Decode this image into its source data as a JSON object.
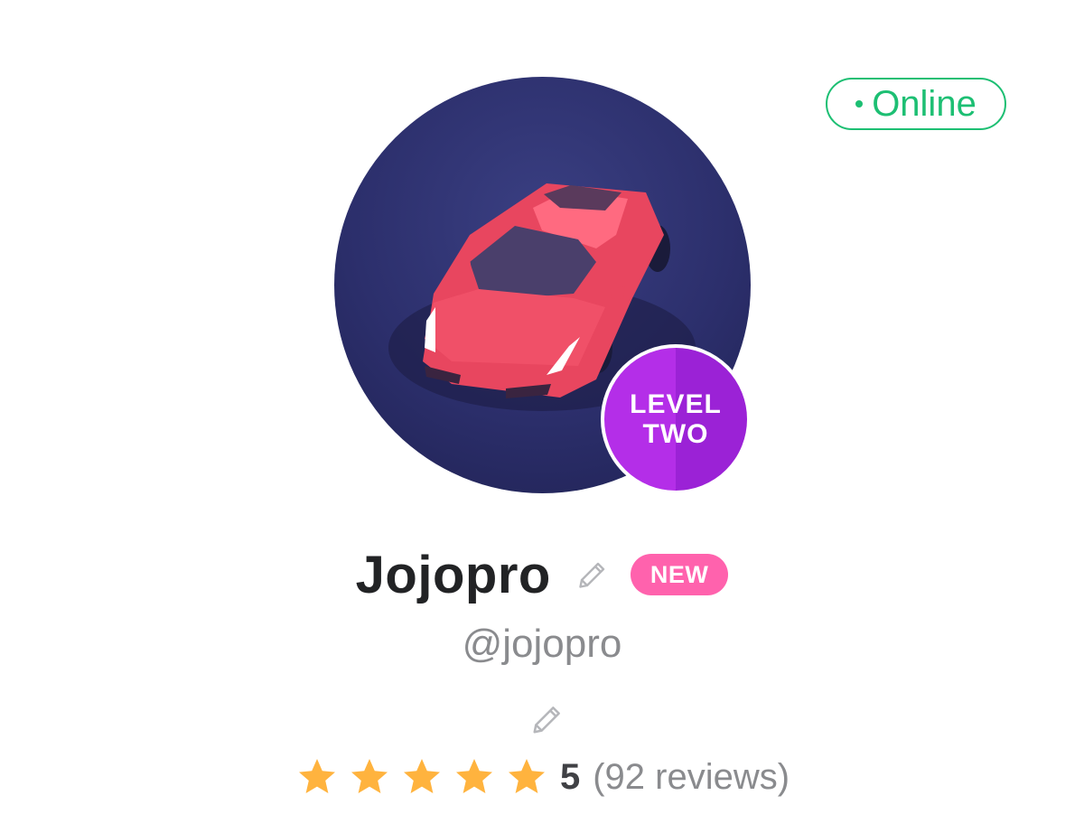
{
  "status": {
    "label": "Online",
    "color": "#1dbf73"
  },
  "avatar": {
    "icon": "sports-car-avatar"
  },
  "level_badge": {
    "line1": "LEVEL",
    "line2": "TWO"
  },
  "profile": {
    "name": "Jojopro",
    "new_badge": "NEW",
    "username": "@jojopro",
    "edit_icon": "pencil-icon"
  },
  "rating": {
    "stars": 5,
    "score": "5",
    "reviews": "(92 reviews)",
    "star_color": "#ffb33e"
  },
  "colors": {
    "accent_green": "#1dbf73",
    "new_pink": "#ff62ad",
    "level_purple": "#b42ee8",
    "text_dark": "#222325",
    "text_muted": "#8a8b8e"
  }
}
